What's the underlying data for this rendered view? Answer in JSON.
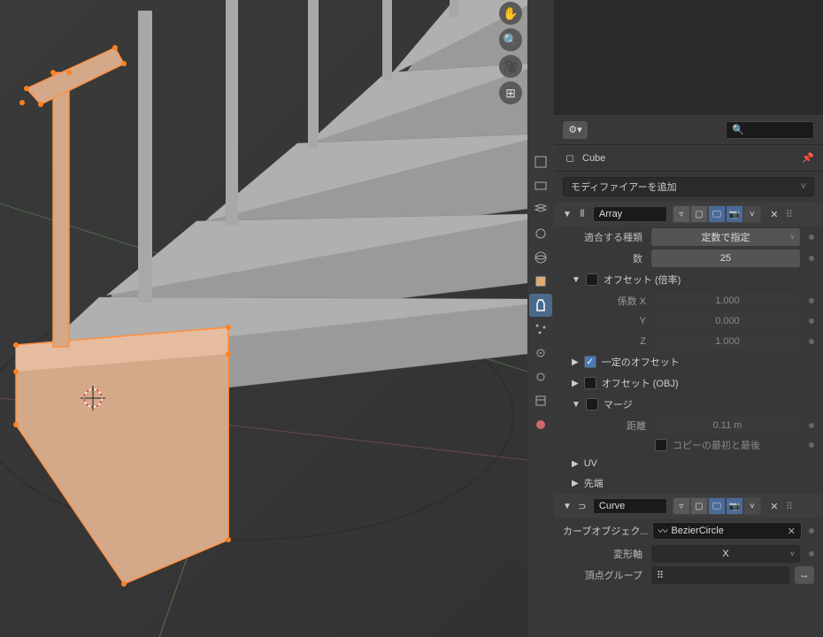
{
  "breadcrumb": {
    "object_name": "Cube"
  },
  "add_modifier_label": "モディファイアーを追加",
  "modifiers": {
    "array": {
      "name": "Array",
      "fit_type_label": "適合する種類",
      "fit_type_value": "定数で指定",
      "count_label": "数",
      "count_value": "25",
      "offset_relative": {
        "header": "オフセット (倍率)",
        "x_label": "係数 X",
        "x": "1.000",
        "y_label": "Y",
        "y": "0.000",
        "z_label": "Z",
        "z": "1.000"
      },
      "offset_constant": {
        "header": "一定のオフセット"
      },
      "offset_object": {
        "header": "オフセット (OBJ)"
      },
      "merge": {
        "header": "マージ",
        "distance_label": "距離",
        "distance": "0.11 m",
        "first_last_label": "コピーの最初と最後"
      },
      "uv_header": "UV",
      "caps_header": "先端"
    },
    "curve": {
      "name": "Curve",
      "curve_object_label": "カーブオブジェク...",
      "curve_object_value": "BezierCircle",
      "deform_axis_label": "変形軸",
      "deform_axis_value": "X",
      "vgroup_label": "頂点グループ"
    }
  },
  "search_placeholder": ""
}
